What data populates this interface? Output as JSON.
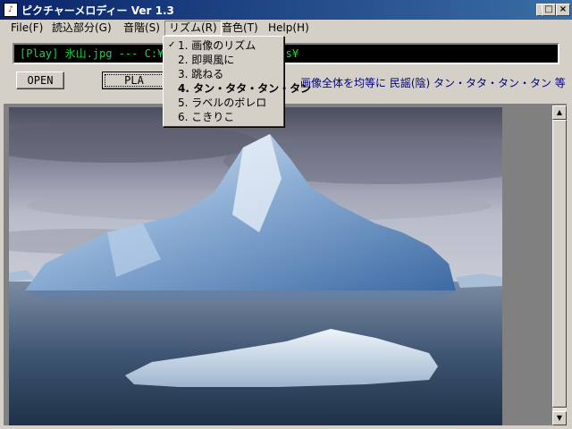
{
  "window": {
    "title": "ピクチャーメロディー  Ver 1.3",
    "icon": "app-icon",
    "min": "_",
    "max": "□",
    "close": "×"
  },
  "menu": [
    {
      "label": "File(F)"
    },
    {
      "label": "読込部分(G)"
    },
    {
      "label": "音階(S)"
    },
    {
      "label": "リズム(R)"
    },
    {
      "label": "音色(T)"
    },
    {
      "label": "Help(H)"
    }
  ],
  "status": {
    "prefix": "[Play] 氷山.jpg --- C:¥",
    "suffix": "ures¥"
  },
  "buttons": {
    "open": "OPEN",
    "play": "PLA"
  },
  "info": "画像全体を均等に 民謡(陰) タン・タタ・タン・タン 等",
  "rhythm_menu": [
    {
      "label": "1. 画像のリズム",
      "checked": true,
      "bold": false
    },
    {
      "label": "2. 即興風に",
      "checked": false,
      "bold": false
    },
    {
      "label": "3. 跳ねる",
      "checked": false,
      "bold": false
    },
    {
      "label": "4. タン・タタ・タン・タン",
      "checked": false,
      "bold": true
    },
    {
      "label": "5. ラベルのボレロ",
      "checked": false,
      "bold": false
    },
    {
      "label": "6. こきりこ",
      "checked": false,
      "bold": false
    }
  ],
  "scroll": {
    "up": "▲",
    "down": "▼"
  },
  "check_glyph": "✓"
}
